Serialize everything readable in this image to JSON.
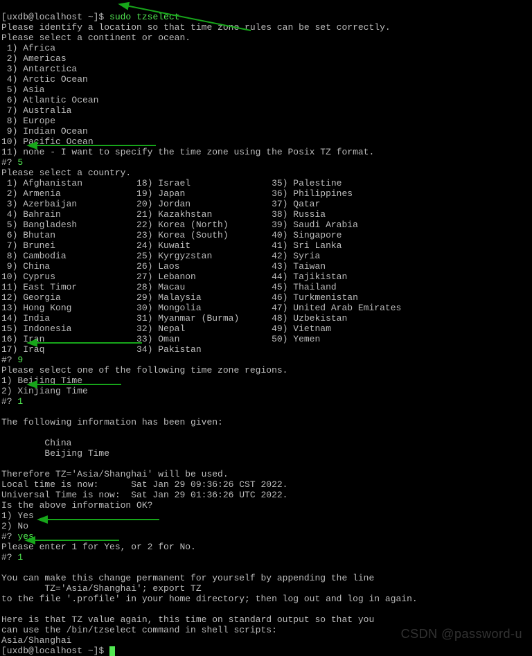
{
  "prompt_user": "[uxdb@localhost ~]$ ",
  "cmd": "sudo tzselect",
  "line_identify": "Please identify a location so that time zone rules can be set correctly.",
  "line_sel_cont": "Please select a continent or ocean.",
  "continents": [
    " 1) Africa",
    " 2) Americas",
    " 3) Antarctica",
    " 4) Arctic Ocean",
    " 5) Asia",
    " 6) Atlantic Ocean",
    " 7) Australia",
    " 8) Europe",
    " 9) Indian Ocean",
    "10) Pacific Ocean",
    "11) none - I want to specify the time zone using the Posix TZ format."
  ],
  "ans1_p": "#? ",
  "ans1_v": "5",
  "line_sel_country": "Please select a country.",
  "countries": [
    " 1) Afghanistan          18) Israel               35) Palestine",
    " 2) Armenia              19) Japan                36) Philippines",
    " 3) Azerbaijan           20) Jordan               37) Qatar",
    " 4) Bahrain              21) Kazakhstan           38) Russia",
    " 5) Bangladesh           22) Korea (North)        39) Saudi Arabia",
    " 6) Bhutan               23) Korea (South)        40) Singapore",
    " 7) Brunei               24) Kuwait               41) Sri Lanka",
    " 8) Cambodia             25) Kyrgyzstan           42) Syria",
    " 9) China                26) Laos                 43) Taiwan",
    "10) Cyprus               27) Lebanon              44) Tajikistan",
    "11) East Timor           28) Macau                45) Thailand",
    "12) Georgia              29) Malaysia             46) Turkmenistan",
    "13) Hong Kong            30) Mongolia             47) United Arab Emirates",
    "14) India                31) Myanmar (Burma)      48) Uzbekistan",
    "15) Indonesia            32) Nepal                49) Vietnam",
    "16) Iran                 33) Oman                 50) Yemen",
    "17) Iraq                 34) Pakistan"
  ],
  "ans2_p": "#? ",
  "ans2_v": "9",
  "line_sel_region": "Please select one of the following time zone regions.",
  "regions": [
    "1) Beijing Time",
    "2) Xinjiang Time"
  ],
  "ans3_p": "#? ",
  "ans3_v": "1",
  "blank": "",
  "info_hdr": "The following information has been given:",
  "info_lines": [
    "        China",
    "        Beijing Time"
  ],
  "therefore": "Therefore TZ='Asia/Shanghai' will be used.",
  "local_time": "Local time is now:      Sat Jan 29 09:36:26 CST 2022.",
  "utc_time": "Universal Time is now:  Sat Jan 29 01:36:26 UTC 2022.",
  "is_ok": "Is the above information OK?",
  "yes_no": [
    "1) Yes",
    "2) No"
  ],
  "ans4_p": "#? ",
  "ans4_v": "yes",
  "please_enter": "Please enter 1 for Yes, or 2 for No.",
  "ans5_p": "#? ",
  "ans5_v": "1",
  "perm1": "You can make this change permanent for yourself by appending the line",
  "perm2": "        TZ='Asia/Shanghai'; export TZ",
  "perm3": "to the file '.profile' in your home directory; then log out and log in again.",
  "here1": "Here is that TZ value again, this time on standard output so that you",
  "here2": "can use the /bin/tzselect command in shell scripts:",
  "tz_out": "Asia/Shanghai",
  "prompt2": "[uxdb@localhost ~]$ ",
  "watermark": "CSDN @password-u"
}
